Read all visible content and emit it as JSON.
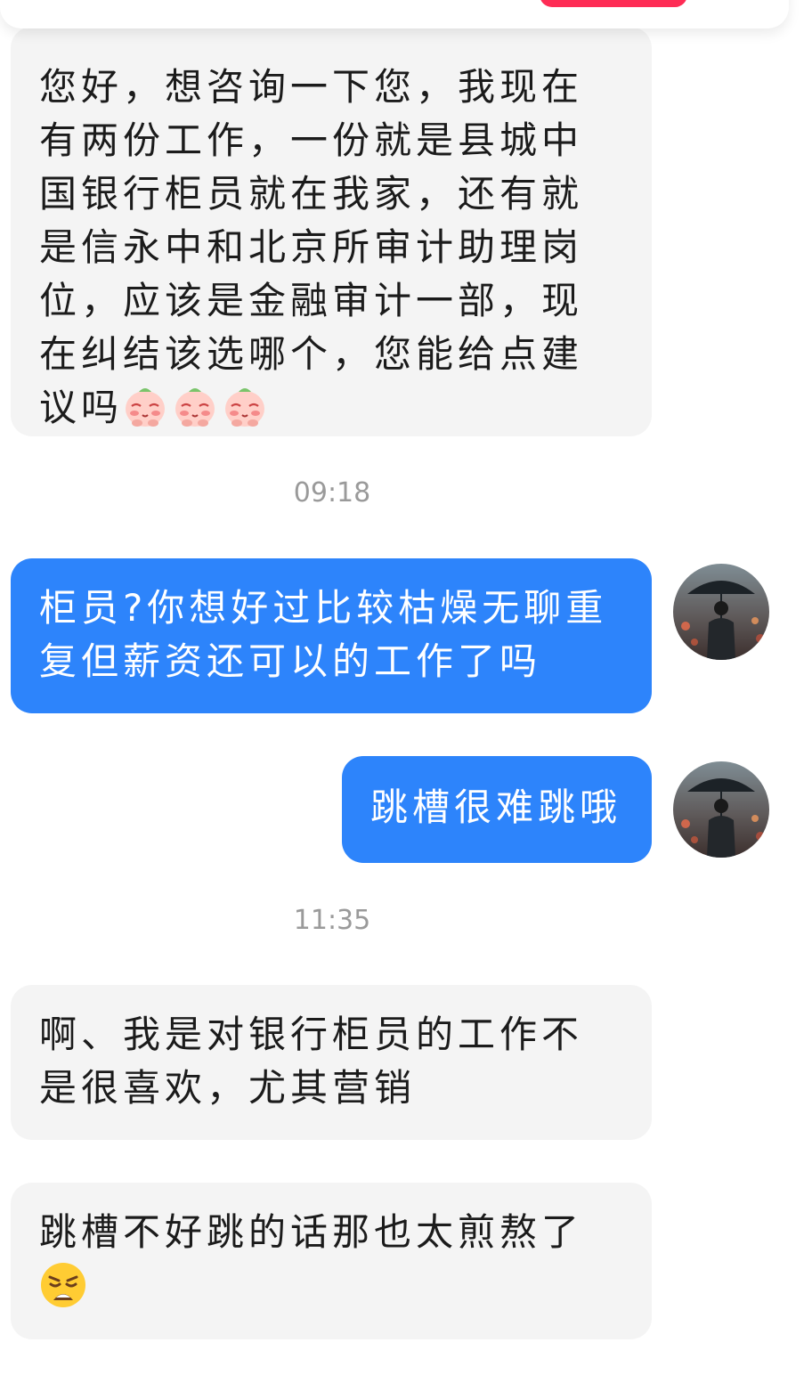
{
  "messages": [
    {
      "text": "您好，想咨询一下您，我现在有两份工作，一份就是县城中国银行柜员就在我家，还有就是信永中和北京所审计助理岗位，应该是金融审计一部，现在纠结该选哪个，您能给点建议吗",
      "emoji": [
        "peach-emoji",
        "peach-emoji",
        "peach-emoji"
      ]
    },
    {
      "time": "09:18"
    },
    {
      "text": "柜员?你想好过比较枯燥无聊重复但薪资还可以的工作了吗"
    },
    {
      "text": "跳槽很难跳哦"
    },
    {
      "time": "11:35"
    },
    {
      "text": "啊、我是对银行柜员的工作不是很喜欢，尤其营销"
    },
    {
      "text": "跳槽不好跳的话那也太煎熬了",
      "emoji": [
        "weary-face-emoji"
      ]
    }
  ],
  "colors": {
    "outgoing_bubble": "#2d84fb",
    "incoming_bubble": "#f4f4f4",
    "timestamp": "#9a9a9a",
    "top_accent": "#fe2c55"
  }
}
